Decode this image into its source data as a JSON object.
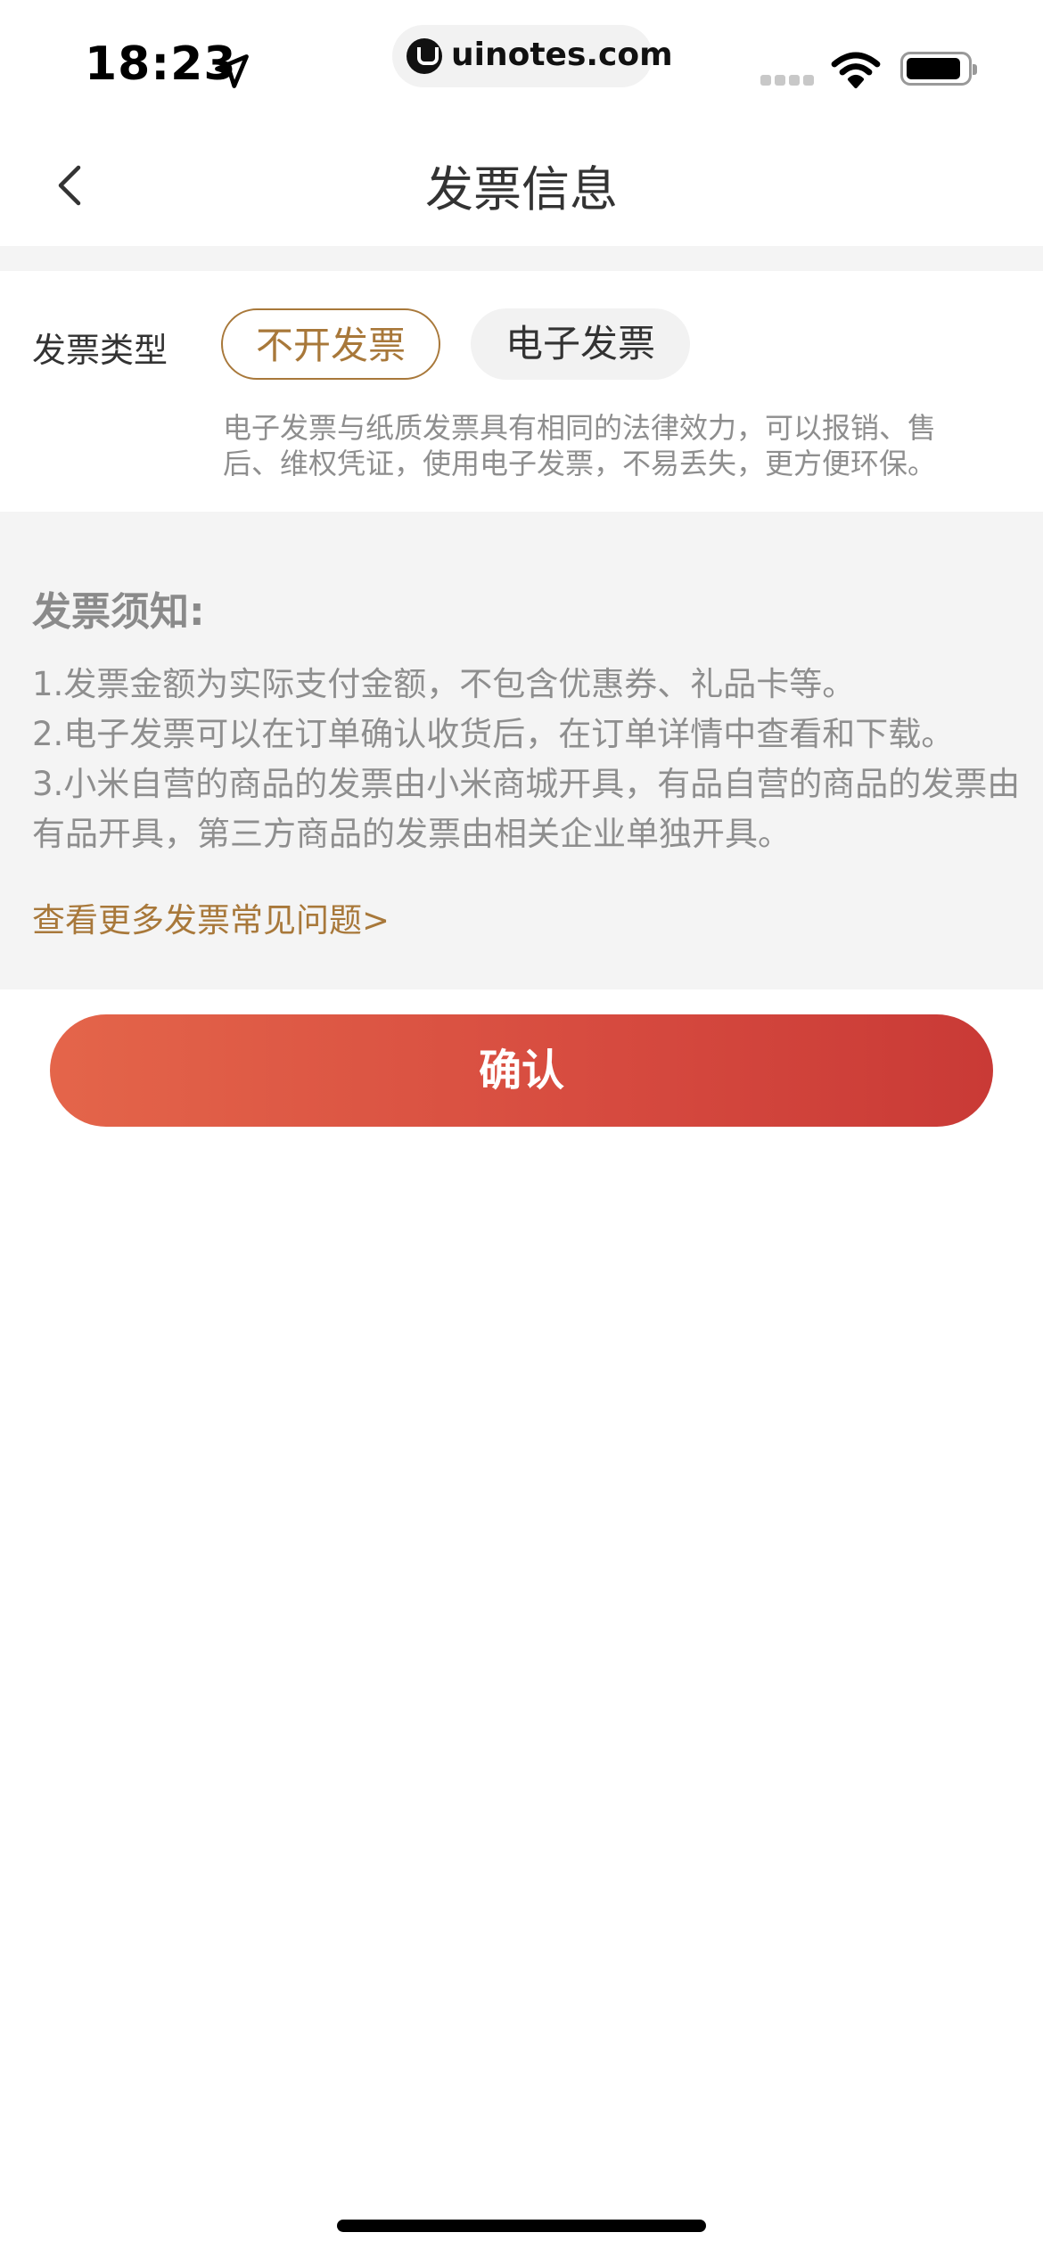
{
  "status_bar": {
    "time": "18:23",
    "watermark": "uinotes.com",
    "icons": [
      "location-arrow-icon",
      "signal-icon",
      "wifi-icon",
      "battery-icon"
    ]
  },
  "nav": {
    "back_icon": "chevron-left-icon",
    "title": "发票信息"
  },
  "invoice_type": {
    "label": "发票类型",
    "options": [
      {
        "label": "不开发票",
        "selected": true
      },
      {
        "label": "电子发票",
        "selected": false
      }
    ],
    "description": "电子发票与纸质发票具有相同的法律效力，可以报销、售后、维权凭证，使用电子发票，不易丢失，更方便环保。"
  },
  "notice": {
    "title": "发票须知:",
    "items": [
      "1.发票金额为实际支付金额，不包含优惠券、礼品卡等。",
      "2.电子发票可以在订单确认收货后，在订单详情中查看和下载。",
      "3.小米自营的商品的发票由小米商城开具，有品自营的商品的发票由有品开具，第三方商品的发票由相关企业单独开具。"
    ],
    "faq_link": "查看更多发票常见问题>"
  },
  "confirm_button": {
    "label": "确认"
  },
  "colors": {
    "accent_gold": "#a8783a",
    "button_gradient_start": "#e4654a",
    "button_gradient_end": "#c93a36",
    "notice_background": "#f4f4f4"
  }
}
